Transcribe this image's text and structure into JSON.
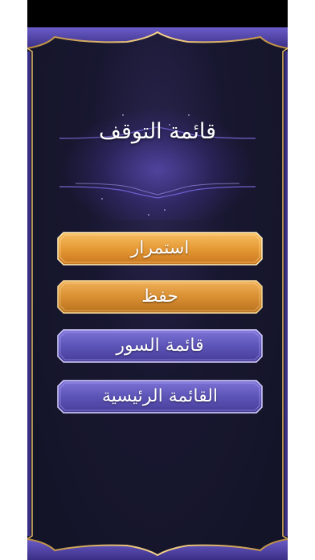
{
  "pause_menu": {
    "title": "قائمة التوقف",
    "buttons": [
      {
        "label": "استمرار",
        "style": "gold"
      },
      {
        "label": "حفظ",
        "style": "gold"
      },
      {
        "label": "قائمة السور",
        "style": "purple"
      },
      {
        "label": "القائمة الرئيسية",
        "style": "purple"
      }
    ]
  },
  "colors": {
    "panel_bg": "#141428",
    "frame_purple": "#5a4bb0",
    "frame_gold": "#e2b866",
    "button_gold": "#e49a3a",
    "button_purple": "#5c53b8"
  }
}
